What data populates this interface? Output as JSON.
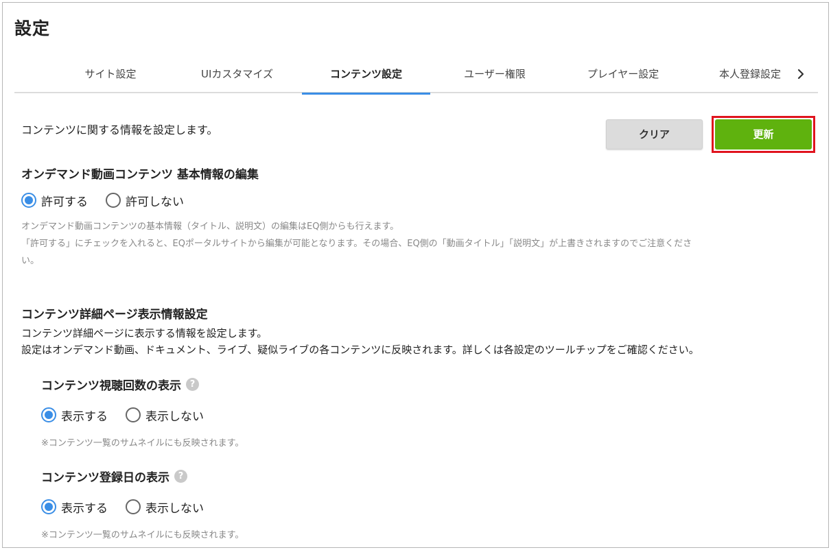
{
  "page": {
    "title": "設定"
  },
  "tabs": [
    {
      "label": "サイト設定"
    },
    {
      "label": "UIカスタマイズ"
    },
    {
      "label": "コンテンツ設定"
    },
    {
      "label": "ユーザー権限"
    },
    {
      "label": "プレイヤー設定"
    },
    {
      "label": "本人登録設定"
    }
  ],
  "active_tab": "コンテンツ設定",
  "tab_next_icon": "chevron-right-icon",
  "intro": "コンテンツに関する情報を設定します。",
  "buttons": {
    "clear": "クリア",
    "update": "更新"
  },
  "colors": {
    "update": "#5fb20e",
    "highlight": "#e0141e",
    "accent": "#3a8ee6",
    "clear": "#dcdcdc"
  },
  "vod_section": {
    "title": "オンデマンド動画コンテンツ 基本情報の編集",
    "options": [
      "許可する",
      "許可しない"
    ],
    "selected": "許可する",
    "notes": [
      "オンデマンド動画コンテンツの基本情報（タイトル、説明文）の編集はEQ側からも行えます。",
      "「許可する」にチェックを入れると、EQポータルサイトから編集が可能となります。その場合、EQ側の「動画タイトル」「説明文」が上書きされますのでご注意くださ",
      "い。"
    ]
  },
  "detail_section": {
    "title": "コンテンツ詳細ページ表示情報設定",
    "description": [
      "コンテンツ詳細ページに表示する情報を設定します。",
      "設定はオンデマンド動画、ドキュメント、ライブ、疑似ライブの各コンテンツに反映されます。詳しくは各設定のツールチップをご確認ください。"
    ],
    "settings": [
      {
        "title": "コンテンツ視聴回数の表示",
        "help_icon": "question-mark-icon",
        "help_glyph": "?",
        "options": [
          "表示する",
          "表示しない"
        ],
        "selected": "表示する",
        "note": "※コンテンツ一覧のサムネイルにも反映されます。"
      },
      {
        "title": "コンテンツ登録日の表示",
        "help_icon": "question-mark-icon",
        "help_glyph": "?",
        "options": [
          "表示する",
          "表示しない"
        ],
        "selected": "表示する",
        "note": "※コンテンツ一覧のサムネイルにも反映されます。"
      }
    ]
  }
}
